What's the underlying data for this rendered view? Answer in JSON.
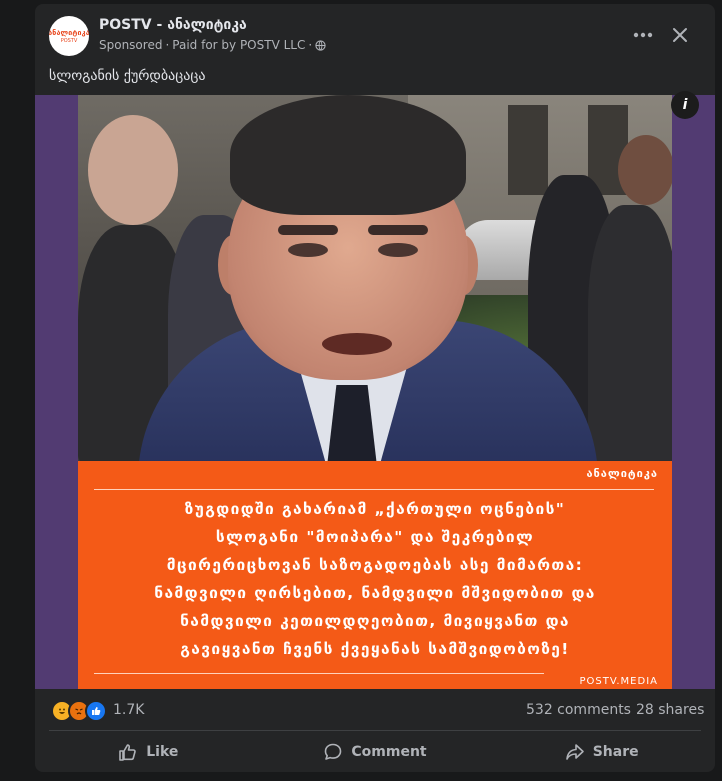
{
  "post": {
    "page_name": "POSTV - ანალიტიკა",
    "sponsored": "Sponsored",
    "dot": "·",
    "paid_for": "Paid for by POSTV LLC",
    "text": "სლოგანის ქურდბაცაცა",
    "avatar_logo": "ანალიტიკა",
    "avatar_logo_sub": "POSTV"
  },
  "media": {
    "tag": "ანალიტიკა",
    "quote_lines": [
      "ზუგდიდში გახარიამ „ქართული ოცნების\"",
      "სლოგანი \"მოიპარა\" და შეკრებილ",
      "მცირერიცხოვან საზოგადოებას ასე მიმართა:",
      "ნამდვილი ღირსებით, ნამდვილი მშვიდობით და",
      "ნამდვილი კეთილდღეობით, მივიყვანთ და",
      "გავიყვანთ ჩვენს ქვეყანას სამშვიდობოზე!"
    ],
    "source": "POSTV.MEDIA",
    "info": "i"
  },
  "stats": {
    "reactions": "1.7K",
    "comments": "532 comments",
    "shares": "28 shares"
  },
  "actions": {
    "like": "Like",
    "comment": "Comment",
    "share": "Share"
  },
  "icons": {
    "more": "more-icon",
    "close": "close-icon",
    "globe": "globe-icon",
    "like": "thumbs-up-icon",
    "comment": "comment-bubble-icon",
    "share": "share-arrow-icon"
  },
  "colors": {
    "card_bg": "#242526",
    "media_frame": "#523b72",
    "quote_bg": "#f45a17",
    "text_primary": "#e4e6eb",
    "text_secondary": "#b0b3b8"
  }
}
